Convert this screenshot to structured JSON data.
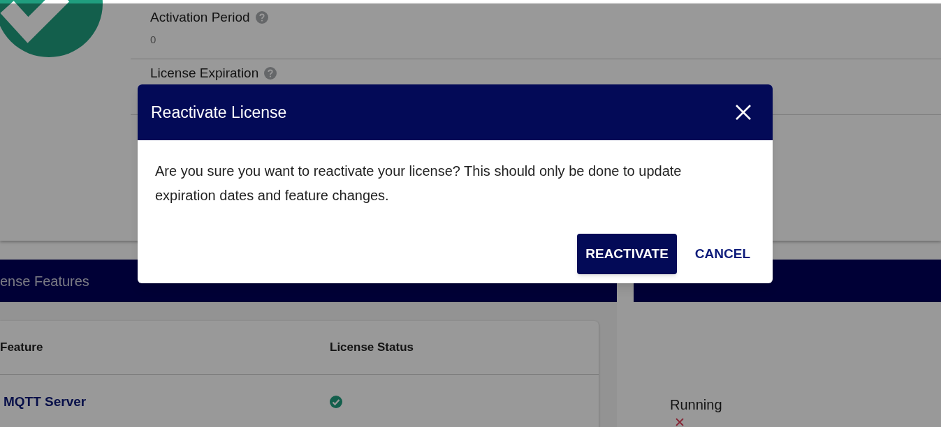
{
  "details": [
    {
      "label": "Activation Period",
      "value": "0"
    },
    {
      "label": "License Expiration"
    }
  ],
  "features_panel": {
    "title": "ense Features",
    "columns": [
      "Feature",
      "License Status"
    ],
    "rows": [
      {
        "feature": "MQTT Server",
        "licensed": true
      }
    ]
  },
  "meter_panel": {
    "status": "Running",
    "running": false
  },
  "dialog": {
    "title": "Reactivate License",
    "message": "Are you sure you want to reactivate your license? This should only be done to update expiration dates and feature changes.",
    "buttons": [
      {
        "label": "REACTIVATE",
        "kind": "primary"
      },
      {
        "label": "CANCEL",
        "kind": "text"
      }
    ]
  }
}
